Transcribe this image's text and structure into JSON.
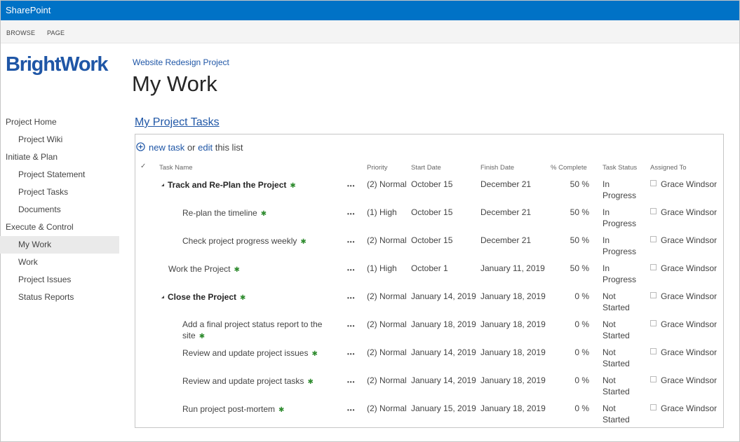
{
  "suitebar": {
    "brand": "SharePoint"
  },
  "ribbon": {
    "tabs": [
      "BROWSE",
      "PAGE"
    ]
  },
  "logo": {
    "text": "BrightWork"
  },
  "nav": {
    "items": [
      {
        "label": "Project Home",
        "level": 0
      },
      {
        "label": "Project Wiki",
        "level": 1
      },
      {
        "label": "Initiate & Plan",
        "level": 0
      },
      {
        "label": "Project Statement",
        "level": 1
      },
      {
        "label": "Project Tasks",
        "level": 1
      },
      {
        "label": "Documents",
        "level": 1
      },
      {
        "label": "Execute & Control",
        "level": 0
      },
      {
        "label": "My Work",
        "level": 1,
        "selected": true
      },
      {
        "label": "Work",
        "level": 1
      },
      {
        "label": "Project Issues",
        "level": 1
      },
      {
        "label": "Status Reports",
        "level": 1
      }
    ]
  },
  "page": {
    "breadcrumb": "Website Redesign Project",
    "title": "My Work"
  },
  "webpart": {
    "title": "My Project Tasks",
    "new_task": "new task",
    "or": "or",
    "edit": "edit",
    "this_list": "this list"
  },
  "table": {
    "headers": {
      "check": "✓",
      "task_name": "Task Name",
      "priority": "Priority",
      "start_date": "Start Date",
      "finish_date": "Finish Date",
      "pct": "% Complete",
      "status": "Task Status",
      "assigned": "Assigned To"
    },
    "rows": [
      {
        "name": "Track and Re-Plan the Project",
        "indent": 1,
        "summary": true,
        "priority": "(2) Normal",
        "start": "October 15",
        "finish": "December 21",
        "pct": "50 %",
        "status": "In Progress",
        "assigned": "Grace Windsor"
      },
      {
        "name": "Re-plan the timeline",
        "indent": 2,
        "summary": false,
        "priority": "(1) High",
        "start": "October 15",
        "finish": "December 21",
        "pct": "50 %",
        "status": "In Progress",
        "assigned": "Grace Windsor"
      },
      {
        "name": "Check project progress weekly",
        "indent": 2,
        "summary": false,
        "priority": "(2) Normal",
        "start": "October 15",
        "finish": "December 21",
        "pct": "50 %",
        "status": "In Progress",
        "assigned": "Grace Windsor"
      },
      {
        "name": "Work the Project",
        "indent": 0,
        "summary": false,
        "priority": "(1) High",
        "start": "October 1",
        "finish": "January 11, 2019",
        "pct": "50 %",
        "status": "In Progress",
        "assigned": "Grace Windsor"
      },
      {
        "name": "Close the Project",
        "indent": 1,
        "summary": true,
        "priority": "(2) Normal",
        "start": "January 14, 2019",
        "finish": "January 18, 2019",
        "pct": "0 %",
        "status": "Not Started",
        "assigned": "Grace Windsor"
      },
      {
        "name": "Add a final project status report to the site",
        "indent": 2,
        "summary": false,
        "priority": "(2) Normal",
        "start": "January 18, 2019",
        "finish": "January 18, 2019",
        "pct": "0 %",
        "status": "Not Started",
        "assigned": "Grace Windsor"
      },
      {
        "name": "Review and update project issues",
        "indent": 2,
        "summary": false,
        "priority": "(2) Normal",
        "start": "January 14, 2019",
        "finish": "January 18, 2019",
        "pct": "0 %",
        "status": "Not Started",
        "assigned": "Grace Windsor"
      },
      {
        "name": "Review and update project tasks",
        "indent": 2,
        "summary": false,
        "priority": "(2) Normal",
        "start": "January 14, 2019",
        "finish": "January 18, 2019",
        "pct": "0 %",
        "status": "Not Started",
        "assigned": "Grace Windsor"
      },
      {
        "name": "Run project post-mortem",
        "indent": 2,
        "summary": false,
        "priority": "(2) Normal",
        "start": "January 15, 2019",
        "finish": "January 18, 2019",
        "pct": "0 %",
        "status": "Not Started",
        "assigned": "Grace Windsor"
      }
    ]
  },
  "colors": {
    "suitebar": "#0072c6",
    "link": "#1f56a6",
    "new_icon": "#2e8b2e"
  },
  "icons": {
    "new_item": "new-item-icon",
    "add": "plus-circle-icon",
    "ellipsis": "ellipsis-icon"
  }
}
